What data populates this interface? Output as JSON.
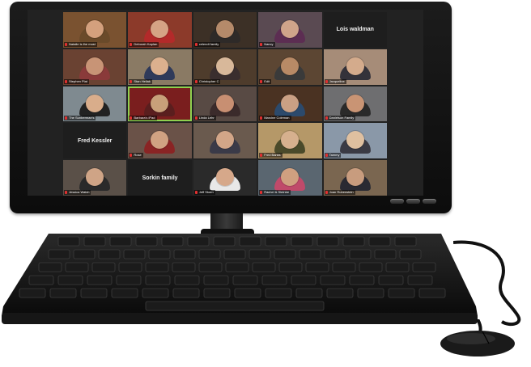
{
  "gallery": {
    "tiles": [
      {
        "label": "Natalie is the most",
        "tone": "#7a5230",
        "head": "#d4a07d",
        "shirt": "#6a4a2a"
      },
      {
        "label": "Deborah Kaplan",
        "tone": "#8c3a2a",
        "head": "#d5a385",
        "shirt": "#b32a2a"
      },
      {
        "label": "celendt family",
        "tone": "#3c3026",
        "head": "#b58a6a",
        "shirt": "#2e2a28"
      },
      {
        "label": "Nancy",
        "tone": "#5a4a52",
        "head": "#cfa48a",
        "shirt": "#5c2d52"
      },
      {
        "label": "Lois waldman",
        "blank": true
      },
      {
        "label": "Stephen Plat",
        "tone": "#6a4232",
        "head": "#c89476",
        "shirt": "#8a3a3a"
      },
      {
        "label": "Stan Heliak",
        "tone": "#8a7a64",
        "head": "#dcb08e",
        "shirt": "#2f3a5a"
      },
      {
        "label": "Christopher C",
        "tone": "#4e3c2c",
        "head": "#d8b89a",
        "shirt": "#3a2e2e"
      },
      {
        "label": "Edit",
        "tone": "#5c4633",
        "head": "#b88a66",
        "shirt": "#3a3a3a"
      },
      {
        "label": "Jacqueline",
        "tone": "#a68c78",
        "head": "#d4ab8c",
        "shirt": "#34323a"
      },
      {
        "label": "The Sunberman's",
        "tone": "#7f8a90",
        "head": "#d9ad8b",
        "shirt": "#222"
      },
      {
        "label": "Barbara's iPad",
        "tone": "#7a1e1e",
        "head": "#c8a07a",
        "shirt": "#5a1e1e",
        "active": true
      },
      {
        "label": "Linda Lehr",
        "tone": "#584a44",
        "head": "#c88f72",
        "shirt": "#3b2b2b"
      },
      {
        "label": "Marcine Coleman",
        "tone": "#4a3222",
        "head": "#caa084",
        "shirt": "#2c4a6c"
      },
      {
        "label": "Danielson Family",
        "tone": "#6e6e70",
        "head": "#c99474",
        "shirt": "#2a2a2a"
      },
      {
        "label": "Fred Kessler",
        "blank": true
      },
      {
        "label": "Rose",
        "tone": "#6a5248",
        "head": "#d0a282",
        "shirt": "#8a2424"
      },
      {
        "label": "",
        "tone": "#6a5a4e",
        "head": "#d2a688",
        "shirt": "#3a3a48"
      },
      {
        "label": "Fred Banks",
        "tone": "#b59868",
        "head": "#d6b08e",
        "shirt": "#4a4a2a"
      },
      {
        "label": "Tammy",
        "tone": "#8a98a8",
        "head": "#dfc0a0",
        "shirt": "#3a3a44"
      },
      {
        "label": "Jessica Walsh",
        "tone": "#5a5048",
        "head": "#cfa486",
        "shirt": "#2a2a2a"
      },
      {
        "label": "Sorkin family",
        "blank": true
      },
      {
        "label": "Jeff Stoen",
        "tone": "#2a2a2a",
        "head": "#d6a88a",
        "shirt": "#e8e8e8"
      },
      {
        "label": "Rachel & Steinbe",
        "tone": "#5a6670",
        "head": "#d0a080",
        "shirt": "#c04a6a"
      },
      {
        "label": "Joan Rubenstein",
        "tone": "#7a6650",
        "head": "#c89c7e",
        "shirt": "#2a2a32"
      }
    ]
  },
  "colors": {
    "frame": "#121212",
    "active_border": "#8fd14f",
    "mute": "#e03030"
  }
}
